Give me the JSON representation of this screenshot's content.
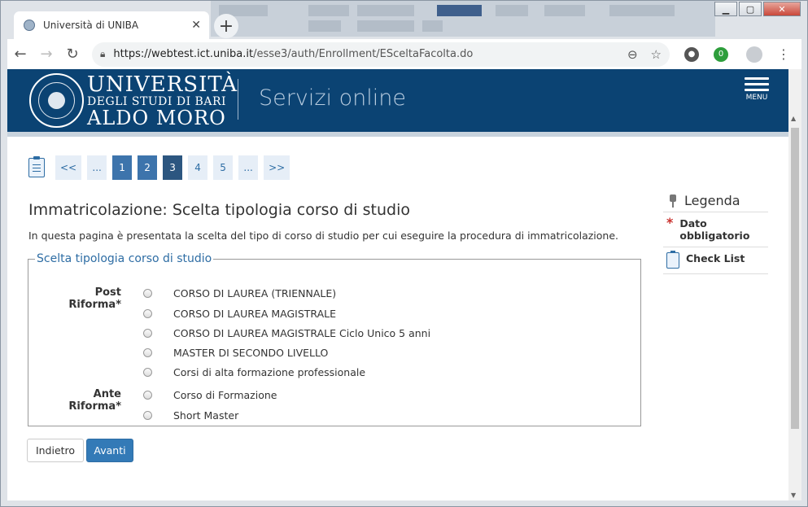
{
  "browser": {
    "tab_title": "Università di UNIBA",
    "url_host": "https://webtest.ict.uniba.it",
    "url_path": "/esse3/auth/Enrollment/ESceltaFacolta.do",
    "extension_badge": "0"
  },
  "site": {
    "brand_line1": "UNIVERSITÀ",
    "brand_line2": "DEGLI STUDI DI BARI",
    "brand_line3": "ALDO MORO",
    "service_title": "Servizi online",
    "menu_label": "MENU"
  },
  "pager": {
    "items": [
      "<<",
      "...",
      "1",
      "2",
      "3",
      "4",
      "5",
      "...",
      ">>"
    ]
  },
  "main": {
    "title": "Immatricolazione: Scelta tipologia corso di studio",
    "intro": "In questa pagina è presentata la scelta del tipo di corso di studio per cui eseguire la procedura di immatricolazione.",
    "fieldset_legend": "Scelta tipologia corso di studio",
    "groups": [
      {
        "label": "Post Riforma*",
        "options": [
          "CORSO DI LAUREA (TRIENNALE)",
          "CORSO DI LAUREA MAGISTRALE",
          "CORSO DI LAUREA MAGISTRALE Ciclo Unico 5 anni",
          "MASTER DI SECONDO LIVELLO",
          "Corsi di alta formazione professionale"
        ]
      },
      {
        "label": "Ante Riforma*",
        "options": [
          "Corso di Formazione",
          "Short Master"
        ]
      }
    ],
    "back_label": "Indietro",
    "next_label": "Avanti"
  },
  "legend": {
    "title": "Legenda",
    "required_label": "Dato obbligatorio",
    "checklist_label": "Check List"
  },
  "colors": {
    "header_bg": "#0b4373",
    "accent": "#337ab7",
    "current_page": "#2c5680"
  }
}
